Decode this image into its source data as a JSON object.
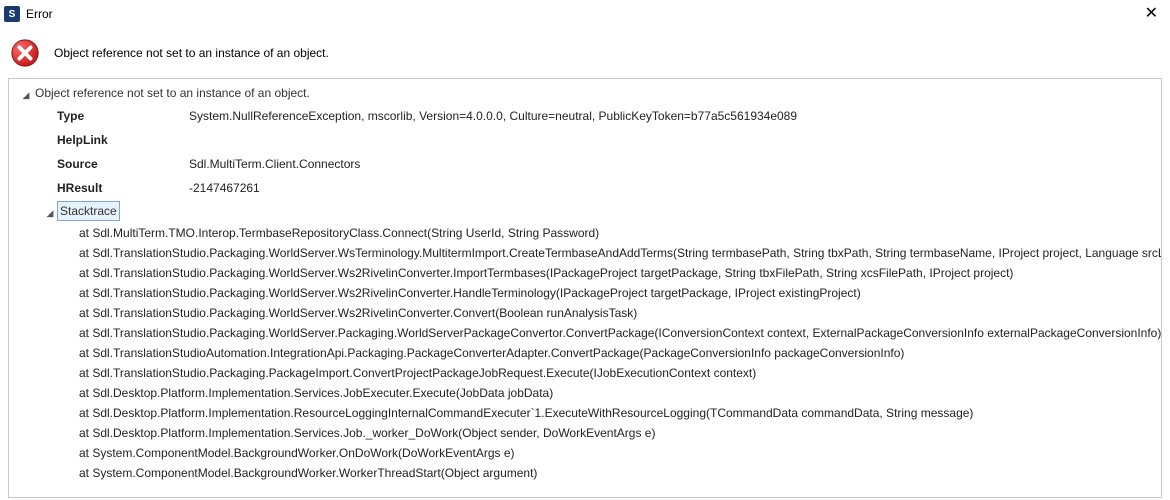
{
  "window": {
    "title": "Error",
    "app_icon_letter": "S",
    "close_glyph": "✕"
  },
  "header": {
    "message": "Object reference not set to an instance of an object."
  },
  "details": {
    "root_label": "Object reference not set to an instance of an object.",
    "props": {
      "type_label": "Type",
      "type_value": "System.NullReferenceException, mscorlib, Version=4.0.0.0, Culture=neutral, PublicKeyToken=b77a5c561934e089",
      "helplink_label": "HelpLink",
      "helplink_value": "",
      "source_label": "Source",
      "source_value": "Sdl.MultiTerm.Client.Connectors",
      "hresult_label": "HResult",
      "hresult_value": "-2147467261"
    },
    "stacktrace_label": "Stacktrace",
    "stacktrace": [
      "at Sdl.MultiTerm.TMO.Interop.TermbaseRepositoryClass.Connect(String UserId, String Password)",
      "at Sdl.TranslationStudio.Packaging.WorldServer.WsTerminology.MultitermImport.CreateTermbaseAndAddTerms(String termbasePath, String tbxPath, String termbaseName, IProject project, Language srcLanguage)",
      "at Sdl.TranslationStudio.Packaging.WorldServer.Ws2RivelinConverter.ImportTermbases(IPackageProject targetPackage, String tbxFilePath, String xcsFilePath, IProject project)",
      "at Sdl.TranslationStudio.Packaging.WorldServer.Ws2RivelinConverter.HandleTerminology(IPackageProject targetPackage, IProject existingProject)",
      "at Sdl.TranslationStudio.Packaging.WorldServer.Ws2RivelinConverter.Convert(Boolean runAnalysisTask)",
      "at Sdl.TranslationStudio.Packaging.WorldServer.Packaging.WorldServerPackageConvertor.ConvertPackage(IConversionContext context, ExternalPackageConversionInfo externalPackageConversionInfo)",
      "at Sdl.TranslationStudioAutomation.IntegrationApi.Packaging.PackageConverterAdapter.ConvertPackage(PackageConversionInfo packageConversionInfo)",
      "at Sdl.TranslationStudio.Packaging.PackageImport.ConvertProjectPackageJobRequest.Execute(IJobExecutionContext context)",
      "at Sdl.Desktop.Platform.Implementation.Services.JobExecuter.Execute(JobData jobData)",
      "at Sdl.Desktop.Platform.Implementation.ResourceLoggingInternalCommandExecuter`1.ExecuteWithResourceLogging(TCommandData commandData, String message)",
      "at Sdl.Desktop.Platform.Implementation.Services.Job._worker_DoWork(Object sender, DoWorkEventArgs e)",
      "at System.ComponentModel.BackgroundWorker.OnDoWork(DoWorkEventArgs e)",
      "at System.ComponentModel.BackgroundWorker.WorkerThreadStart(Object argument)"
    ]
  }
}
